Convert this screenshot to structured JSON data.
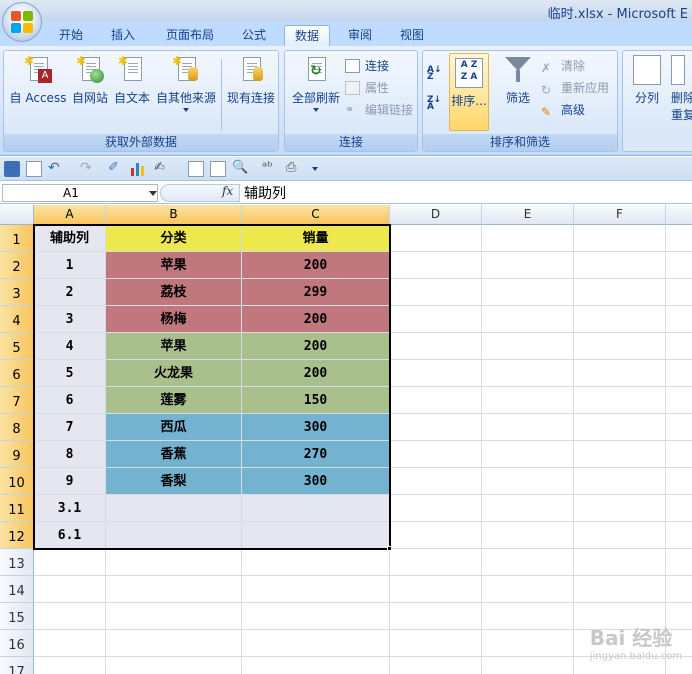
{
  "window": {
    "title": "临时.xlsx - Microsoft E"
  },
  "tabs": [
    "开始",
    "插入",
    "页面布局",
    "公式",
    "数据",
    "审阅",
    "视图"
  ],
  "active_tab": "数据",
  "ribbon": {
    "groups": {
      "external": {
        "label": "获取外部数据",
        "buttons": [
          "自 Access",
          "自网站",
          "自文本",
          "自其他来源",
          "现有连接"
        ]
      },
      "connections": {
        "label": "连接",
        "refresh": "全部刷新",
        "connect": "连接",
        "properties": "属性",
        "edit_links": "编辑链接"
      },
      "sort_filter": {
        "label": "排序和筛选",
        "sort": "排序...",
        "filter": "筛选",
        "clear": "清除",
        "reapply": "重新应用",
        "advanced": "高级"
      },
      "tools": {
        "split": "分列",
        "remove": "删除",
        "duplicates": "重复"
      }
    }
  },
  "formula_bar": {
    "name_box": "A1",
    "fx": "fx",
    "formula": "辅助列"
  },
  "columns": [
    "A",
    "B",
    "C",
    "D",
    "E",
    "F"
  ],
  "rows": [
    "1",
    "2",
    "3",
    "4",
    "5",
    "6",
    "7",
    "8",
    "9",
    "10",
    "11",
    "12",
    "13",
    "14",
    "15",
    "16",
    "17"
  ],
  "sheet": {
    "header": [
      "辅助列",
      "分类",
      "销量"
    ],
    "data": [
      [
        "1",
        "苹果",
        "200"
      ],
      [
        "2",
        "荔枝",
        "299"
      ],
      [
        "3",
        "杨梅",
        "200"
      ],
      [
        "4",
        "苹果",
        "200"
      ],
      [
        "5",
        "火龙果",
        "200"
      ],
      [
        "6",
        "莲雾",
        "150"
      ],
      [
        "7",
        "西瓜",
        "300"
      ],
      [
        "8",
        "香蕉",
        "270"
      ],
      [
        "9",
        "香梨",
        "300"
      ],
      [
        "3.1",
        "",
        ""
      ],
      [
        "6.1",
        "",
        ""
      ]
    ]
  },
  "colors": {
    "header_fill": "#ede84d",
    "group1_fill": "#c0777d",
    "group2_fill": "#a9bf8c",
    "group3_fill": "#74b3cf",
    "aux_fill": "#e6e6f0"
  },
  "watermark": {
    "brand": "Bai 经验",
    "url": "jingyan.baidu.com"
  }
}
